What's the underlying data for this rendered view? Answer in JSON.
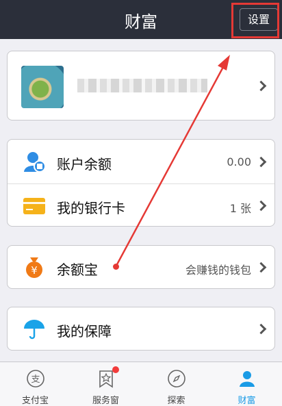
{
  "navbar": {
    "title": "财富",
    "settings_label": "设置"
  },
  "account": {
    "rows": [
      {
        "label": "账户余额",
        "value": "0.00"
      },
      {
        "label": "我的银行卡",
        "value": "1 张"
      }
    ]
  },
  "yuebao": {
    "label": "余额宝",
    "value": "会赚钱的钱包"
  },
  "insurance": {
    "label": "我的保障"
  },
  "tabs": [
    {
      "label": "支付宝"
    },
    {
      "label": "服务窗"
    },
    {
      "label": "探索"
    },
    {
      "label": "财富"
    }
  ],
  "colors": {
    "navbar": "#2b2f3a",
    "accent": "#1a9be6",
    "highlight": "#e53935",
    "badge": "#f23c3c"
  }
}
